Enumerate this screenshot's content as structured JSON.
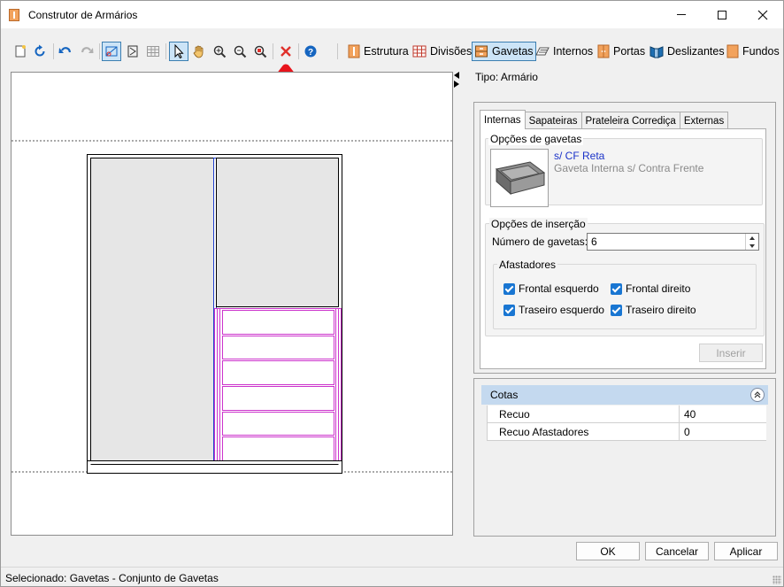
{
  "window": {
    "title": "Construtor de Armários"
  },
  "toolbar": {
    "tabs": [
      {
        "label": "Estrutura",
        "icon": "estrutura-icon"
      },
      {
        "label": "Divisões",
        "icon": "grid-icon"
      },
      {
        "label": "Gavetas",
        "icon": "drawer-icon",
        "active": true
      },
      {
        "label": "Internos",
        "icon": "internos-icon"
      },
      {
        "label": "Portas",
        "icon": "door-icon"
      },
      {
        "label": "Deslizantes",
        "icon": "sliding-door-icon"
      },
      {
        "label": "Fundos",
        "icon": "back-panel-icon"
      }
    ]
  },
  "right": {
    "tipo": "Tipo: Armário",
    "tabs": [
      "Internas",
      "Sapateiras",
      "Prateleira Corrediça",
      "Externas"
    ],
    "opcoes_gavetas": {
      "title": "Opções de gavetas",
      "item_name": "s/ CF Reta",
      "item_desc": "Gaveta Interna s/ Contra Frente"
    },
    "opcoes_insercao": {
      "title": "Opções de inserção",
      "numero_label": "Número de gavetas:",
      "numero_value": "6",
      "afastadores_title": "Afastadores",
      "checks": [
        {
          "label": "Frontal esquerdo",
          "checked": true
        },
        {
          "label": "Frontal direito",
          "checked": true
        },
        {
          "label": "Traseiro esquerdo",
          "checked": true
        },
        {
          "label": "Traseiro direito",
          "checked": true
        }
      ]
    },
    "inserir_label": "Inserir",
    "cotas": {
      "title": "Cotas",
      "rows": [
        {
          "name": "Recuo",
          "value": "40"
        },
        {
          "name": "Recuo Afastadores",
          "value": "0"
        }
      ]
    }
  },
  "buttons": {
    "ok": "OK",
    "cancel": "Cancelar",
    "apply": "Aplicar"
  },
  "status": "Selecionado: Gavetas - Conjunto de Gavetas",
  "colors": {
    "accent": "#1976d2",
    "selection": "#cc33cc",
    "division": "#1f3fcf",
    "annotation_arrow": "#e8141c"
  }
}
